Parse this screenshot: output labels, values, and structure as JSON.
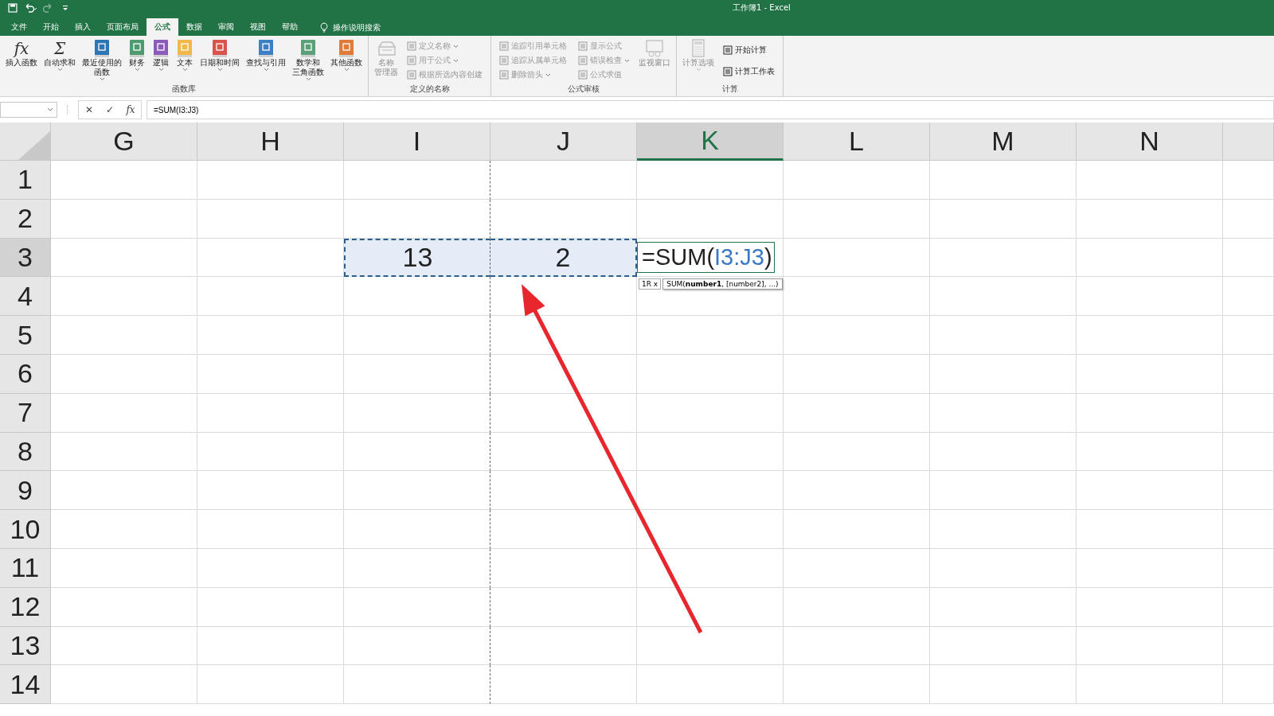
{
  "title_bar": {
    "title": "工作簿1  -  Excel",
    "quick_access": [
      {
        "kind": "save",
        "disabled": false
      },
      {
        "kind": "undo",
        "disabled": false
      },
      {
        "kind": "redo",
        "disabled": true
      },
      {
        "kind": "customize",
        "disabled": false
      }
    ]
  },
  "tabs": [
    {
      "label": "文件",
      "selected": false
    },
    {
      "label": "开始",
      "selected": false
    },
    {
      "label": "插入",
      "selected": false
    },
    {
      "label": "页面布局",
      "selected": false
    },
    {
      "label": "公式",
      "selected": true
    },
    {
      "label": "数据",
      "selected": false
    },
    {
      "label": "审阅",
      "selected": false
    },
    {
      "label": "视图",
      "selected": false
    },
    {
      "label": "帮助",
      "selected": false
    }
  ],
  "tell_me": {
    "placeholder": "操作说明搜索"
  },
  "ribbon": [
    {
      "label": "函数库",
      "columns": [
        {
          "kind": "glyph",
          "icon_text": "fx",
          "lines": [
            "插入函数"
          ],
          "dropdown": false,
          "disabled": false
        },
        {
          "kind": "glyph",
          "icon_text": "Σ",
          "lines": [
            "自动求和"
          ],
          "dropdown": true,
          "disabled": false
        },
        {
          "kind": "book",
          "color": "#2e75b6",
          "lines": [
            "最近使用的",
            "函数"
          ],
          "dropdown": true,
          "disabled": false
        },
        {
          "kind": "book",
          "color": "#4f9a6e",
          "lines": [
            "财务"
          ],
          "dropdown": true,
          "disabled": false
        },
        {
          "kind": "book",
          "color": "#8a5bb8",
          "lines": [
            "逻辑"
          ],
          "dropdown": true,
          "disabled": false
        },
        {
          "kind": "book",
          "color": "#f2b84b",
          "lines": [
            "文本"
          ],
          "dropdown": true,
          "disabled": false
        },
        {
          "kind": "book",
          "color": "#d9534a",
          "lines": [
            "日期和时间"
          ],
          "dropdown": true,
          "disabled": false
        },
        {
          "kind": "book",
          "color": "#3b7fc4",
          "lines": [
            "查找与引用"
          ],
          "dropdown": true,
          "disabled": false
        },
        {
          "kind": "book",
          "color": "#5aa17a",
          "lines": [
            "数学和",
            "三角函数"
          ],
          "dropdown": true,
          "disabled": false
        },
        {
          "kind": "book",
          "color": "#e07b39",
          "lines": [
            "其他函数"
          ],
          "dropdown": true,
          "disabled": false
        }
      ]
    },
    {
      "label": "定义的名称",
      "columns": [
        {
          "kind": "tray",
          "lines": [
            "名称",
            "管理器"
          ],
          "dropdown": false,
          "disabled": true
        },
        {
          "kind": "stack",
          "items": [
            {
              "label": "定义名称",
              "dropdown": true,
              "disabled": true
            },
            {
              "label": "用于公式",
              "dropdown": true,
              "disabled": true
            },
            {
              "label": "根据所选内容创建",
              "dropdown": false,
              "disabled": true
            }
          ]
        }
      ]
    },
    {
      "label": "公式审核",
      "columns": [
        {
          "kind": "stack",
          "items": [
            {
              "label": "追踪引用单元格",
              "dropdown": false,
              "disabled": true
            },
            {
              "label": "追踪从属单元格",
              "dropdown": false,
              "disabled": true
            },
            {
              "label": "删除箭头",
              "dropdown": true,
              "disabled": true
            }
          ]
        },
        {
          "kind": "stack",
          "items": [
            {
              "label": "显示公式",
              "dropdown": false,
              "disabled": true
            },
            {
              "label": "错误检查",
              "dropdown": true,
              "disabled": true
            },
            {
              "label": "公式求值",
              "dropdown": false,
              "disabled": true
            }
          ]
        },
        {
          "kind": "window",
          "lines": [
            "监视窗口"
          ],
          "dropdown": false,
          "disabled": true
        }
      ]
    },
    {
      "label": "计算",
      "columns": [
        {
          "kind": "calculator",
          "lines": [
            "计算选项"
          ],
          "dropdown": true,
          "disabled": true
        },
        {
          "kind": "stack",
          "items": [
            {
              "label": "开始计算",
              "dropdown": false,
              "disabled": false
            },
            {
              "label": "计算工作表",
              "dropdown": false,
              "disabled": false
            }
          ]
        }
      ]
    }
  ],
  "formula_bar": {
    "cancel": "✕",
    "enter": "✓",
    "function_glyph": "fx",
    "value": "=SUM(I3:J3)"
  },
  "grid": {
    "columns": [
      {
        "label": "G",
        "selected": false,
        "page_break_after": false
      },
      {
        "label": "H",
        "selected": false,
        "page_break_after": false
      },
      {
        "label": "I",
        "selected": false,
        "page_break_after": true
      },
      {
        "label": "J",
        "selected": false,
        "page_break_after": false
      },
      {
        "label": "K",
        "selected": true,
        "page_break_after": false
      },
      {
        "label": "L",
        "selected": false,
        "page_break_after": false
      },
      {
        "label": "M",
        "selected": false,
        "page_break_after": false
      },
      {
        "label": "N",
        "selected": false,
        "page_break_after": false
      }
    ],
    "rows": [
      {
        "label": "1",
        "selected": false
      },
      {
        "label": "2",
        "selected": false
      },
      {
        "label": "3",
        "selected": true,
        "cells": [
          {
            "kind": "empty"
          },
          {
            "kind": "empty"
          },
          {
            "kind": "value",
            "value": "13",
            "in_range": true
          },
          {
            "kind": "value",
            "value": "2",
            "in_range": true
          },
          {
            "kind": "formula",
            "prefix": "=SUM(",
            "reference": "I3:J3",
            "suffix": ")",
            "size_hint": "1R x",
            "syntax": "SUM(**number1**, [number2], ...)"
          },
          {
            "kind": "empty"
          },
          {
            "kind": "empty"
          },
          {
            "kind": "empty"
          }
        ]
      },
      {
        "label": "4",
        "selected": false
      },
      {
        "label": "5",
        "selected": false
      },
      {
        "label": "6",
        "selected": false
      },
      {
        "label": "7",
        "selected": false
      },
      {
        "label": "8",
        "selected": false
      },
      {
        "label": "9",
        "selected": false
      },
      {
        "label": "10",
        "selected": false
      },
      {
        "label": "11",
        "selected": false
      },
      {
        "label": "12",
        "selected": false
      },
      {
        "label": "13",
        "selected": false
      },
      {
        "label": "14",
        "selected": false
      }
    ]
  }
}
